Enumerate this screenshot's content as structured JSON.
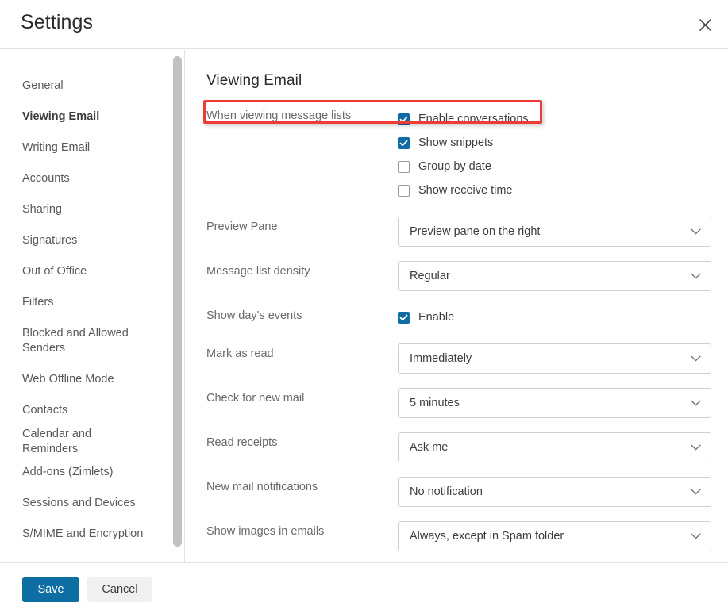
{
  "header": {
    "title": "Settings",
    "close_icon": "close-icon"
  },
  "sidebar": {
    "items": [
      {
        "label": "General",
        "active": false,
        "wrap": false
      },
      {
        "label": "Viewing Email",
        "active": true,
        "wrap": false
      },
      {
        "label": "Writing Email",
        "active": false,
        "wrap": false
      },
      {
        "label": "Accounts",
        "active": false,
        "wrap": false
      },
      {
        "label": "Sharing",
        "active": false,
        "wrap": false
      },
      {
        "label": "Signatures",
        "active": false,
        "wrap": false
      },
      {
        "label": "Out of Office",
        "active": false,
        "wrap": false
      },
      {
        "label": "Filters",
        "active": false,
        "wrap": false
      },
      {
        "label": "Blocked and Allowed Senders",
        "active": false,
        "wrap": true
      },
      {
        "label": "Web Offline Mode",
        "active": false,
        "wrap": false
      },
      {
        "label": "Contacts",
        "active": false,
        "wrap": false
      },
      {
        "label": "Calendar and Reminders",
        "active": false,
        "wrap": false
      },
      {
        "label": "Add-ons (Zimlets)",
        "active": false,
        "wrap": false
      },
      {
        "label": "Sessions and Devices",
        "active": false,
        "wrap": false
      },
      {
        "label": "S/MIME and Encryption",
        "active": false,
        "wrap": false
      }
    ]
  },
  "main": {
    "title": "Viewing Email",
    "message_lists": {
      "label": "When viewing message lists",
      "options": [
        {
          "label": "Enable conversations",
          "checked": true
        },
        {
          "label": "Show snippets",
          "checked": true
        },
        {
          "label": "Group by date",
          "checked": false
        },
        {
          "label": "Show receive time",
          "checked": false
        }
      ]
    },
    "preview_pane": {
      "label": "Preview Pane",
      "value": "Preview pane on the right"
    },
    "message_list_density": {
      "label": "Message list density",
      "value": "Regular"
    },
    "show_days_events": {
      "label": "Show day's events",
      "checkbox_label": "Enable",
      "checked": true
    },
    "mark_as_read": {
      "label": "Mark as read",
      "value": "Immediately"
    },
    "check_for_new_mail": {
      "label": "Check for new mail",
      "value": "5 minutes"
    },
    "read_receipts": {
      "label": "Read receipts",
      "value": "Ask me"
    },
    "new_mail_notifications": {
      "label": "New mail notifications",
      "value": "No notification"
    },
    "show_images_in_emails": {
      "label": "Show images in emails",
      "value": "Always, except in Spam folder"
    }
  },
  "footer": {
    "save_label": "Save",
    "cancel_label": "Cancel"
  },
  "colors": {
    "accent_blue": "#0d6ea4",
    "checkbox_blue": "#0e6ba3",
    "highlight_red": "#ef3b33",
    "border_gray": "#cfcfcf",
    "label_gray": "#6a6a6c"
  }
}
